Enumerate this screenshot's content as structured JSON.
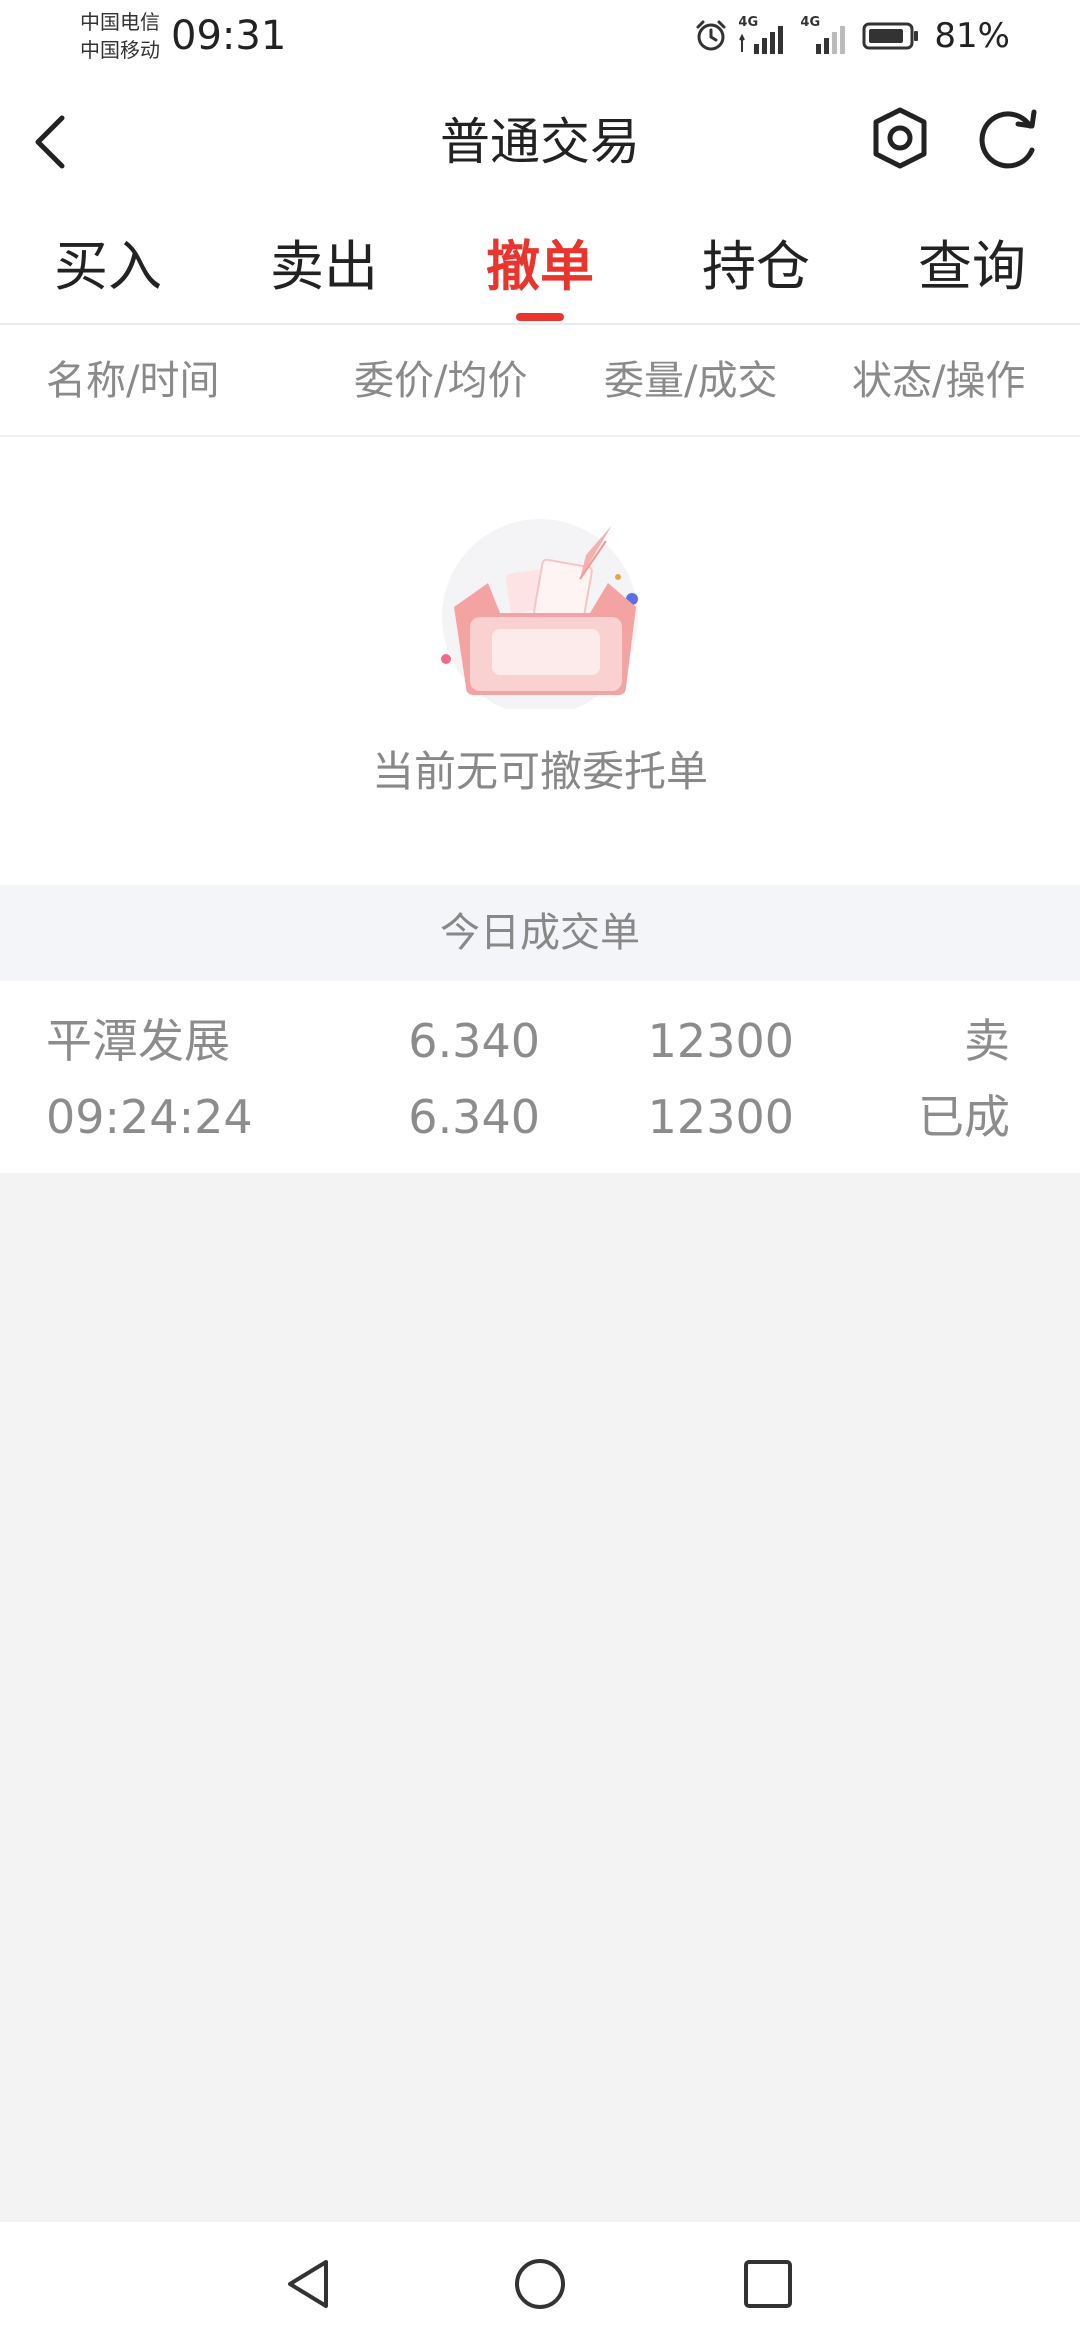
{
  "status_bar": {
    "carrier_1": "中国电信",
    "carrier_2": "中国移动",
    "time": "09:31",
    "network_1": "4G",
    "network_2": "4G",
    "battery_percent": "81%",
    "icons": [
      "alarm-icon",
      "signal-icon",
      "battery-icon"
    ]
  },
  "header": {
    "title": "普通交易",
    "icons": [
      "back-icon",
      "settings-icon",
      "refresh-icon"
    ]
  },
  "tabs": [
    {
      "label": "买入",
      "active": false
    },
    {
      "label": "卖出",
      "active": false
    },
    {
      "label": "撤单",
      "active": true
    },
    {
      "label": "持仓",
      "active": false
    },
    {
      "label": "查询",
      "active": false
    }
  ],
  "columns": [
    "名称/时间",
    "委价/均价",
    "委量/成交",
    "状态/操作"
  ],
  "empty_state": {
    "message": "当前无可撤委托单",
    "icon": "empty-box-illustration"
  },
  "today_trades": {
    "title": "今日成交单",
    "rows": [
      {
        "name": "平潭发展",
        "time": "09:24:24",
        "order_price": "6.340",
        "avg_price": "6.340",
        "order_qty": "12300",
        "filled_qty": "12300",
        "direction": "卖",
        "status": "已成"
      }
    ]
  },
  "colors": {
    "accent": "#e8352e",
    "text_primary": "#222222",
    "text_secondary": "#8c8c8c",
    "section_bg": "#f4f5f9",
    "page_bg": "#f3f3f4"
  },
  "nav": {
    "icons": [
      "nav-back-icon",
      "nav-home-icon",
      "nav-recents-icon"
    ]
  }
}
